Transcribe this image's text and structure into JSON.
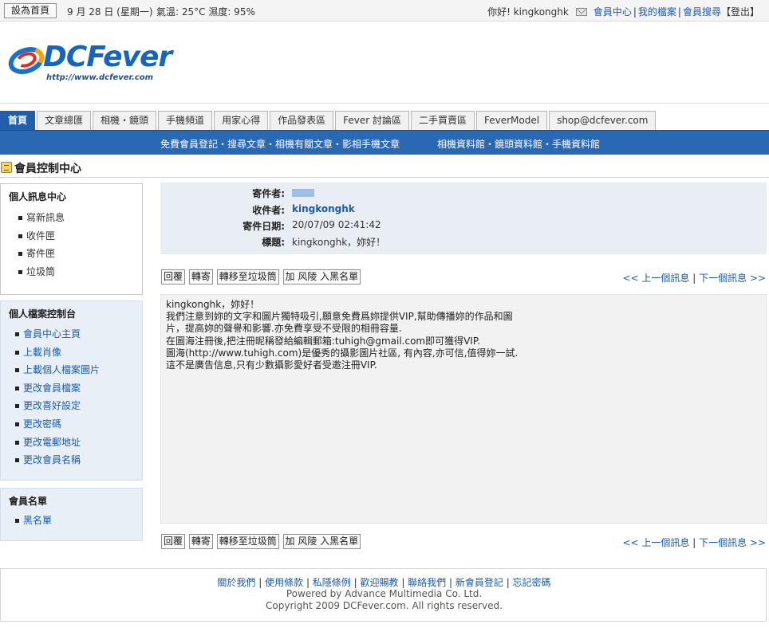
{
  "topbar": {
    "home_button": "設為首頁",
    "date": "9 月 28 日 (星期一)",
    "weather": "氣溫: 25°C  濕度: 95%",
    "greeting": "你好! kingkonghk",
    "links": [
      "會員中心",
      "我的檔案",
      "會員搜尋"
    ],
    "logout": "【登出】"
  },
  "logo": {
    "name": "DCFever",
    "url": "http://www.dcfever.com"
  },
  "tabs": [
    "首頁",
    "文章總匯",
    "相機・鏡頭",
    "手機頻道",
    "用家心得",
    "作品發表區",
    "Fever 討論區",
    "二手買賣區",
    "FeverModel",
    "shop@dcfever.com"
  ],
  "subnav": {
    "group1": "免費會員登記・搜尋文章・相機有關文章・影相手機文章",
    "group2": "相機資料館・鏡頭資料館・手機資料館"
  },
  "page_title": "會員控制中心",
  "sidebar": {
    "messages": {
      "heading": "個人訊息中心",
      "items": [
        "寫新訊息",
        "收件匣",
        "寄件匣",
        "垃圾筒"
      ]
    },
    "profile": {
      "heading": "個人檔案控制台",
      "items": [
        "會員中心主頁",
        "上載肖像",
        "上載個人檔案圖片",
        "更改會員檔案",
        "更改喜好設定",
        "更改密碼",
        "更改電郵地址",
        "更改會員名稱"
      ]
    },
    "members": {
      "heading": "會員名單",
      "items": [
        "黑名單"
      ]
    }
  },
  "message": {
    "sender_label": "寄件者:",
    "recipient_label": "收件者:",
    "recipient": "kingkonghk",
    "date_label": "寄件日期:",
    "date": "20/07/09 02:41:42",
    "subject_label": "標題:",
    "subject": "kingkonghk，妳好！",
    "body": [
      "kingkonghk，妳好！",
      "我們注意到妳的文字和圖片獨特吸引,願意免費爲妳提供VIP,幫助傳播妳的作品和圖",
      "片，提高妳的聲譽和影響.亦免費享受不受限的相冊容量.",
      "在圖海注冊後,把注冊昵稱發給編輯郵箱:tuhigh@gmail.com即可獲得VIP.",
      "圖海(http://www.tuhigh.com)是優秀的攝影圖片社區, 有內容,亦可信,值得妳一試.",
      "這不是廣告信息,只有少數攝影愛好者受邀注冊VIP."
    ]
  },
  "actions": {
    "reply": "回覆",
    "forward": "轉寄",
    "move_trash": "轉移至垃圾筒",
    "blacklist": "加 风陵 入黑名單",
    "prev": "<< 上一個訊息",
    "next": "下一個訊息 >>"
  },
  "footer": {
    "links": [
      "關於我們",
      "使用條款",
      "私隱條例",
      "歡迎賜教",
      "聯絡我們",
      "新會員登記",
      "忘記密碼"
    ],
    "powered": "Powered by Advance Multimedia Co. Ltd.",
    "copyright": "Copyright 2009 DCFever.com. All rights reserved."
  }
}
